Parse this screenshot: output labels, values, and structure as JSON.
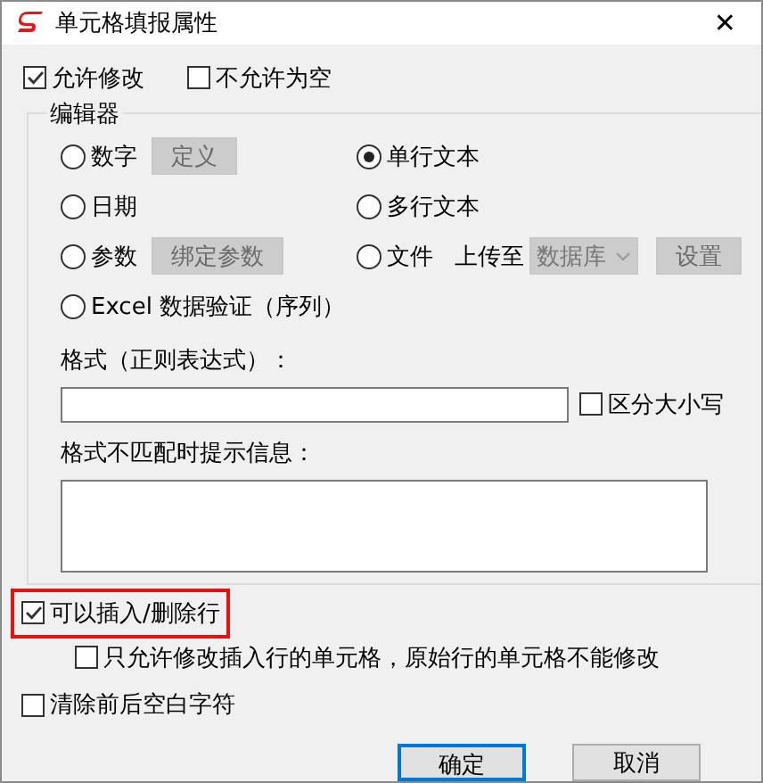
{
  "window": {
    "title": "单元格填报属性",
    "close": "✕"
  },
  "top_options": [
    {
      "label": "允许修改",
      "checked": true
    },
    {
      "label": "不允许为空",
      "checked": false
    }
  ],
  "editor": {
    "title": "编辑器",
    "rows": [
      [
        {
          "kind": "button",
          "label": "数字",
          "selected": false,
          "button": {
            "label": "定义",
            "disabled": true
          }
        },
        {
          "kind": "plain",
          "label": "单行文本",
          "selected": true
        }
      ],
      [
        {
          "kind": "plain",
          "label": "日期",
          "selected": false
        },
        {
          "kind": "plain",
          "label": "多行文本",
          "selected": false
        }
      ],
      [
        {
          "kind": "button",
          "label": "参数",
          "selected": false,
          "button": {
            "label": "绑定参数",
            "disabled": true
          }
        },
        {
          "kind": "upload",
          "label": "文件",
          "selected": false,
          "upload_label": "上传至",
          "select": {
            "value": "数据库",
            "disabled": true
          },
          "button": {
            "label": "设置",
            "disabled": true
          }
        }
      ],
      [
        {
          "kind": "plain",
          "label": "Excel 数据验证（序列）",
          "selected": false
        }
      ]
    ],
    "format_label": "格式（正则表达式）：",
    "case_option": {
      "label": "区分大小写",
      "checked": false
    },
    "message_label": "格式不匹配时提示信息："
  },
  "row_options": [
    {
      "label": "可以插入/删除行",
      "checked": true,
      "highlighted": true,
      "children": [
        {
          "label": "只允许修改插入行的单元格，原始行的单元格不能修改",
          "checked": false
        }
      ]
    },
    {
      "label": "清除前后空白字符",
      "checked": false,
      "highlighted": false
    }
  ],
  "buttons": [
    {
      "label": "确定",
      "default": true
    },
    {
      "label": "取消",
      "default": false
    }
  ]
}
